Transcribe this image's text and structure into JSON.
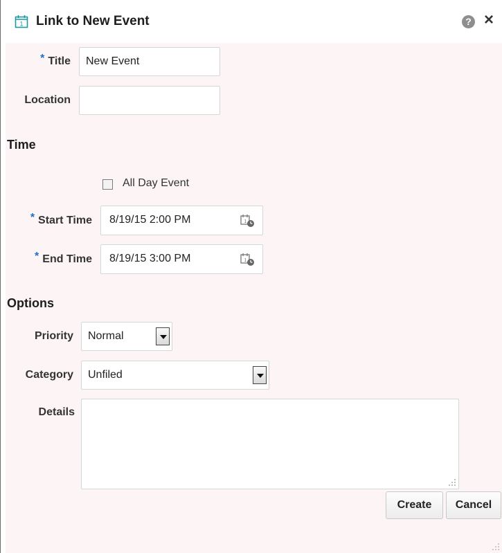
{
  "dialog": {
    "title": "Link to New Event",
    "help_symbol": "?",
    "close_symbol": "×"
  },
  "form": {
    "required_marker": "*",
    "title_label": "Title",
    "title_value": "New Event",
    "location_label": "Location",
    "location_value": "",
    "time_section": "Time",
    "all_day_label": "All Day Event",
    "all_day_checked": false,
    "start_time_label": "Start Time",
    "start_time_value": "8/19/15 2:00 PM",
    "end_time_label": "End Time",
    "end_time_value": "8/19/15 3:00 PM",
    "options_section": "Options",
    "priority_label": "Priority",
    "priority_value": "Normal",
    "category_label": "Category",
    "category_value": "Unfiled",
    "details_label": "Details",
    "details_value": ""
  },
  "buttons": {
    "create": "Create",
    "cancel": "Cancel"
  },
  "icons": {
    "title": "calendar-icon",
    "help": "help-icon",
    "close": "close-icon",
    "datetime": "calendar-clock-icon",
    "dropdown": "chevron-down-icon"
  },
  "colors": {
    "required": "#1f6fc5",
    "calendar_icon": "#1a9aa0",
    "dialog_bg": "#fdf5f5"
  }
}
